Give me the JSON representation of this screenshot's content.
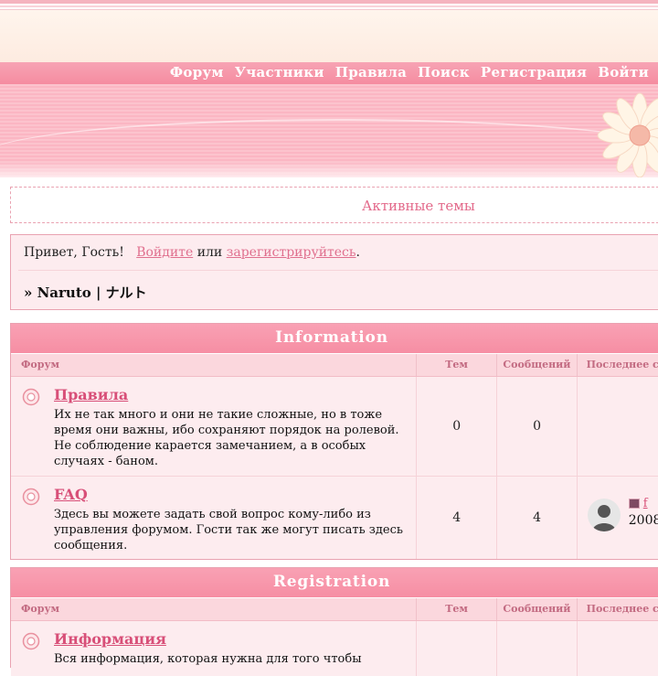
{
  "nav": {
    "items": [
      "Форум",
      "Участники",
      "Правила",
      "Поиск",
      "Регистрация",
      "Войти"
    ]
  },
  "active_topics": "Активные темы",
  "greeting": {
    "prefix": "Привет, Гость!",
    "login": "Войдите",
    "or": "или",
    "register": "зарегистрируйтесь",
    "period": ".",
    "breadcrumb": "» Naruto | ナルト"
  },
  "categories": [
    {
      "title": "Information",
      "cols": {
        "forum": "Форум",
        "topics": "Тем",
        "posts": "Сообщений",
        "last": "Последнее с"
      },
      "forums": [
        {
          "name": "Правила",
          "desc": "Их не так много и они не такие сложные, но в тоже время они важны, ибо сохраняют порядок на ролевой. Не соблюдение карается замечанием, а в особых случаях - баном.",
          "topics": "0",
          "posts": "0"
        },
        {
          "name": "FAQ",
          "desc": "Здесь вы можете задать свой вопрос кому-либо из управления форумом. Гости так же могут писать здесь сообщения.",
          "topics": "4",
          "posts": "4",
          "last_link": "f",
          "last_date": "2008"
        }
      ]
    },
    {
      "title": "Registration",
      "cols": {
        "forum": "Форум",
        "topics": "Тем",
        "posts": "Сообщений",
        "last": "Последнее с"
      },
      "forums": [
        {
          "name": "Информация",
          "desc": "Вся информация, которая нужна для того чтобы"
        }
      ]
    }
  ],
  "colors": {
    "accent": "#f68ea3",
    "link": "#d84f78",
    "border": "#e9a2b1"
  }
}
